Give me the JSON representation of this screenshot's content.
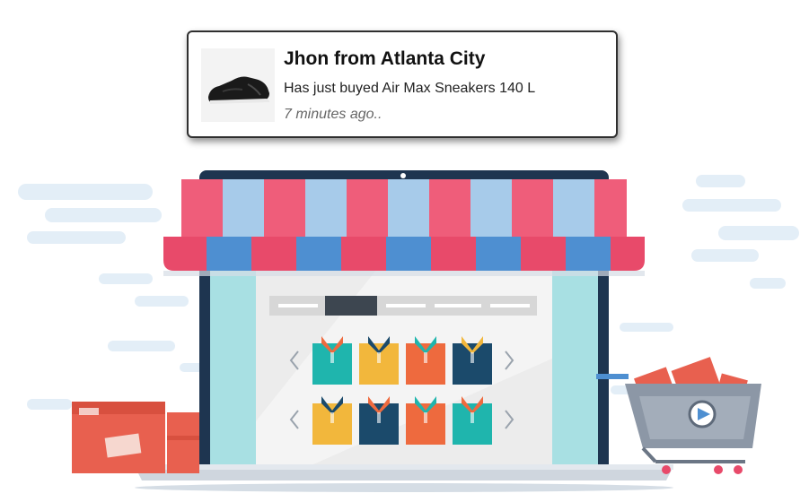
{
  "notification": {
    "title": "Jhon from Atlanta City",
    "message": "Has just buyed Air Max Sneakers 140 L",
    "time": "7 minutes ago..",
    "thumbnail_icon": "sneaker-icon"
  },
  "illustration": {
    "scene_icon": "online-store-laptop-icon",
    "colors": {
      "awning_pink": "#ef5d7a",
      "awning_blue": "#4e8fd1",
      "laptop_dark": "#1e3550",
      "screen_bg": "#a8e0e3",
      "shirt_teal": "#1fb5ad",
      "shirt_yellow": "#f2b73c",
      "shirt_orange": "#ee6a3e",
      "shirt_navy": "#1b4a6b",
      "box_red": "#e8604f",
      "cart_gray": "#8c97a6"
    }
  }
}
